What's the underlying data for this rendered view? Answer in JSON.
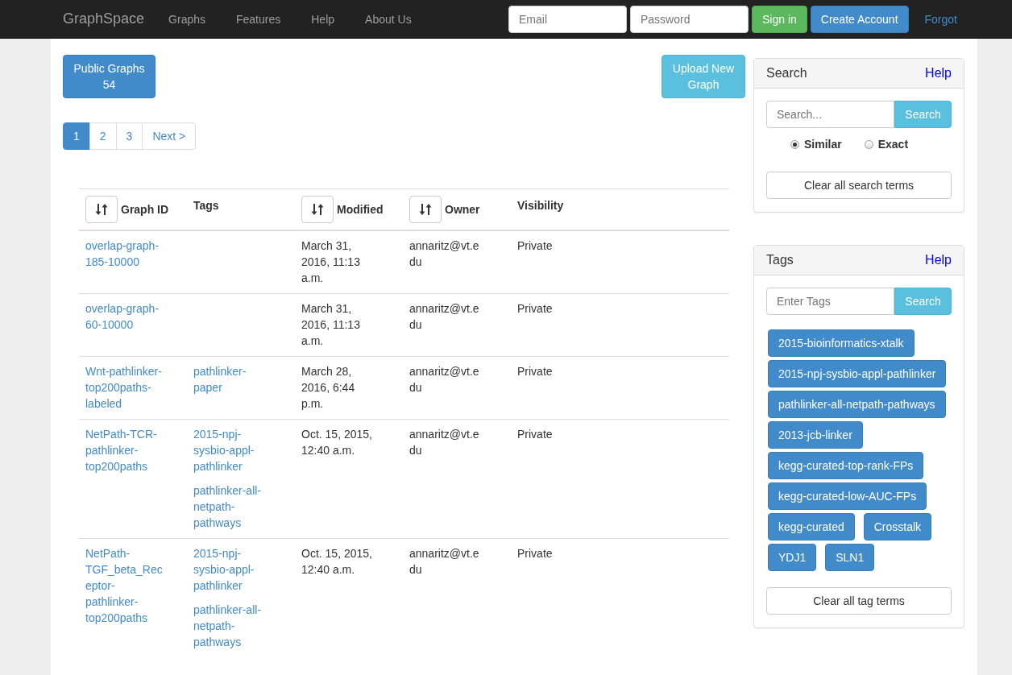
{
  "navbar": {
    "brand": "GraphSpace",
    "links": [
      "Graphs",
      "Features",
      "Help",
      "About Us"
    ],
    "email": {
      "placeholder": "Email"
    },
    "password": {
      "placeholder": "Password"
    },
    "sign_in": "Sign in",
    "create_account": "Create Account",
    "forgot": "Forgot"
  },
  "public_graphs": {
    "label": "Public Graphs",
    "count": "54"
  },
  "upload_button": "Upload New Graph",
  "pagination": [
    {
      "label": "1",
      "selected": true
    },
    {
      "label": "2",
      "selected": false
    },
    {
      "label": "3",
      "selected": false
    },
    {
      "label": "Next >",
      "selected": false
    }
  ],
  "table": {
    "columns": [
      {
        "label": "Graph ID",
        "sortable": true
      },
      {
        "label": "Tags",
        "sortable": false
      },
      {
        "label": "Modified",
        "sortable": true
      },
      {
        "label": "Owner",
        "sortable": true
      },
      {
        "label": "Visibility",
        "sortable": false
      }
    ],
    "rows": [
      {
        "graph_id": "overlap-graph-185-10000",
        "tags": [],
        "modified": "March 31, 2016, 11:13 a.m.",
        "owner": "annaritz@vt.edu",
        "visibility": "Private"
      },
      {
        "graph_id": "overlap-graph-60-10000",
        "tags": [],
        "modified": "March 31, 2016, 11:13 a.m.",
        "owner": "annaritz@vt.edu",
        "visibility": "Private"
      },
      {
        "graph_id": "Wnt-pathlinker-top200paths-labeled",
        "tags": [
          "pathlinker-paper"
        ],
        "modified": "March 28, 2016, 6:44 p.m.",
        "owner": "annaritz@vt.edu",
        "visibility": "Private"
      },
      {
        "graph_id": "NetPath-TCR-pathlinker-top200paths",
        "tags": [
          "2015-npj-sysbio-appl-pathlinker",
          "pathlinker-all-netpath-pathways"
        ],
        "modified": "Oct. 15, 2015, 12:40 a.m.",
        "owner": "annaritz@vt.edu",
        "visibility": "Private"
      },
      {
        "graph_id": "NetPath-TGF_beta_Receptor-pathlinker-top200paths",
        "tags": [
          "2015-npj-sysbio-appl-pathlinker",
          "pathlinker-all-netpath-pathways"
        ],
        "modified": "Oct. 15, 2015, 12:40 a.m.",
        "owner": "annaritz@vt.edu",
        "visibility": "Private"
      }
    ]
  },
  "search_panel": {
    "title": "Search",
    "help": "Help",
    "field": {
      "placeholder": "Search..."
    },
    "button": "Search",
    "modes": [
      {
        "label": "Similar",
        "selected": true
      },
      {
        "label": "Exact",
        "selected": false
      }
    ],
    "clear": "Clear all search terms"
  },
  "tags_panel": {
    "title": "Tags",
    "help": "Help",
    "field": {
      "placeholder": "Enter Tags"
    },
    "button": "Search",
    "tags": [
      "2015-bioinformatics-xtalk",
      "2015-npj-sysbio-appl-pathlinker",
      "pathlinker-all-netpath-pathways",
      "2013-jcb-linker",
      "kegg-curated-top-rank-FPs",
      "kegg-curated-low-AUC-FPs",
      "kegg-curated",
      "Crosstalk",
      "YDJ1",
      "SLN1"
    ],
    "clear": "Clear all tag terms"
  }
}
